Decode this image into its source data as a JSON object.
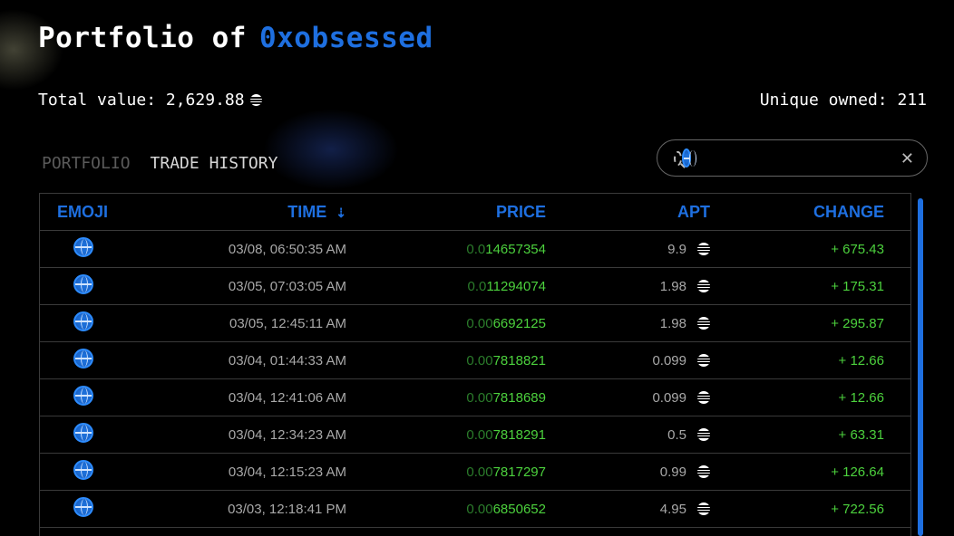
{
  "header": {
    "title_prefix": "Portfolio of",
    "username": "0xobsessed",
    "total_label": "Total value: 2,629.88",
    "unique_label": "Unique owned: 211"
  },
  "tabs": [
    {
      "label": "PORTFOLIO",
      "active": false
    },
    {
      "label": "TRADE HISTORY",
      "active": true
    }
  ],
  "search": {
    "value": "🌐"
  },
  "table": {
    "columns": [
      "EMOJI",
      "TIME",
      "PRICE",
      "APT",
      "CHANGE"
    ],
    "rows": [
      {
        "emoji": "globe",
        "time": "03/08, 06:50:35 AM",
        "price_lead": "0.0",
        "price_main": "14657354",
        "apt": "9.9",
        "change": "+ 675.43"
      },
      {
        "emoji": "globe",
        "time": "03/05, 07:03:05 AM",
        "price_lead": "0.0",
        "price_main": "11294074",
        "apt": "1.98",
        "change": "+ 175.31"
      },
      {
        "emoji": "globe",
        "time": "03/05, 12:45:11 AM",
        "price_lead": "0.00",
        "price_main": "6692125",
        "apt": "1.98",
        "change": "+ 295.87"
      },
      {
        "emoji": "globe",
        "time": "03/04, 01:44:33 AM",
        "price_lead": "0.00",
        "price_main": "7818821",
        "apt": "0.099",
        "change": "+ 12.66"
      },
      {
        "emoji": "globe",
        "time": "03/04, 12:41:06 AM",
        "price_lead": "0.00",
        "price_main": "7818689",
        "apt": "0.099",
        "change": "+ 12.66"
      },
      {
        "emoji": "globe",
        "time": "03/04, 12:34:23 AM",
        "price_lead": "0.00",
        "price_main": "7818291",
        "apt": "0.5",
        "change": "+ 63.31"
      },
      {
        "emoji": "globe",
        "time": "03/04, 12:15:23 AM",
        "price_lead": "0.00",
        "price_main": "7817297",
        "apt": "0.99",
        "change": "+ 126.64"
      },
      {
        "emoji": "globe",
        "time": "03/03, 12:18:41 PM",
        "price_lead": "0.00",
        "price_main": "6850652",
        "apt": "4.95",
        "change": "+ 722.56"
      }
    ]
  },
  "colors": {
    "accent": "#1e6fe0",
    "positive": "#4cd13d",
    "positive_dim": "#2b7c2b"
  },
  "icons": {
    "apt": "apt-icon",
    "search": "search-icon",
    "clear": "close-icon",
    "sort": "arrow-down-icon",
    "emoji": "globe-icon"
  }
}
